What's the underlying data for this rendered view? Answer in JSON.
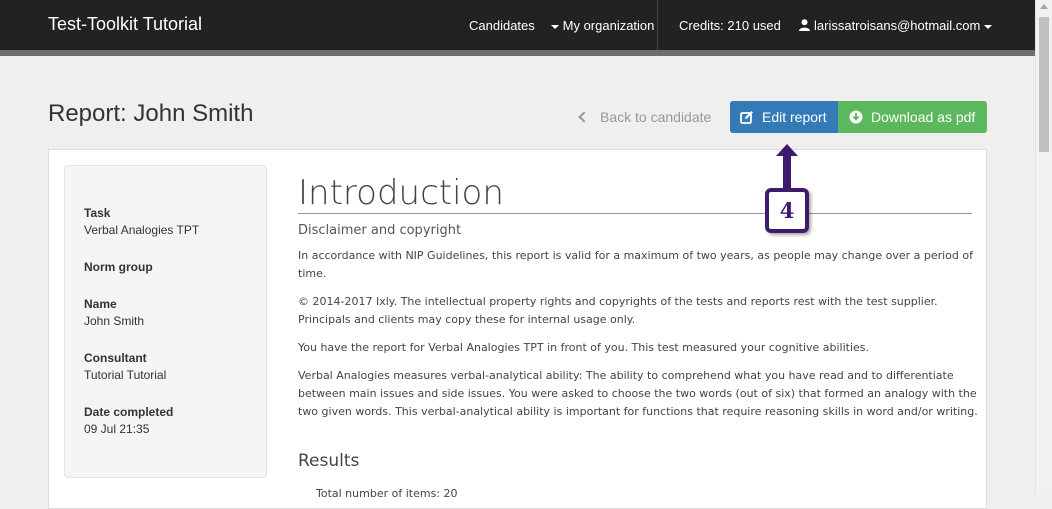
{
  "navbar": {
    "brand": "Test-Toolkit Tutorial",
    "candidates": "Candidates",
    "my_organization": "My organization",
    "credits": "Credits: 210 used",
    "user_email": "larissatroisans@hotmail.com"
  },
  "page": {
    "title": "Report: John Smith",
    "back_link": "Back to candidate",
    "edit_button": "Edit report",
    "download_button": "Download as pdf"
  },
  "sidebar": {
    "task_label": "Task",
    "task_value": "Verbal Analogies TPT",
    "norm_label": "Norm group",
    "name_label": "Name",
    "name_value": "John Smith",
    "consultant_label": "Consultant",
    "consultant_value": "Tutorial Tutorial",
    "date_label": "Date completed",
    "date_value": "09 Jul 21:35"
  },
  "report": {
    "heading": "Introduction",
    "subtitle": "Disclaimer and copyright",
    "para1": "In accordance with NIP Guidelines, this report is valid for a maximum of two years, as people may change over a period of time.",
    "para2": "© 2014-2017 Ixly. The intellectual property rights and copyrights of the tests and reports rest with the test supplier. Principals and clients may copy these for internal usage only.",
    "para3": "You have the report for Verbal Analogies TPT in front of you. This test measured your cognitive abilities.",
    "para4": "Verbal Analogies measures verbal-analytical ability: The ability to comprehend what you have read and to differentiate between main issues and side issues. You were asked to choose the two words (out of six) that formed an analogy with the two given words. This verbal-analytical ability is important for functions that require reasoning skills in word and/or writing.",
    "results_heading": "Results",
    "results_partial": "Total number of items: 20"
  },
  "callout": {
    "number": "4"
  },
  "colors": {
    "navbar": "#222222",
    "primary": "#337ab7",
    "success": "#5cb85c",
    "callout": "#3f1b6b"
  }
}
